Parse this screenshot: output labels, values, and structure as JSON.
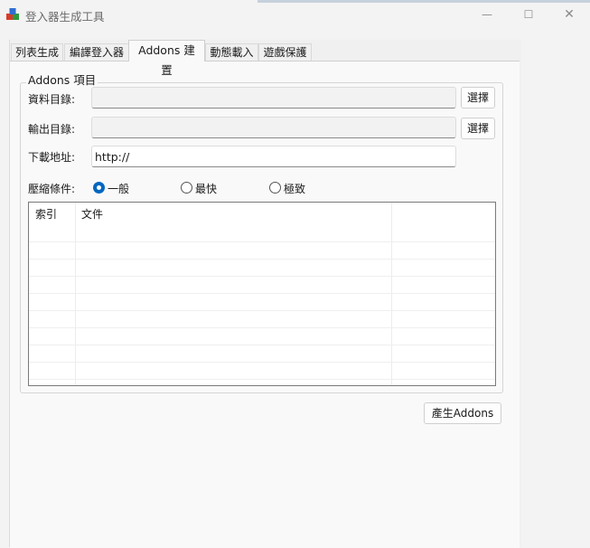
{
  "window": {
    "title": "登入器生成工具",
    "minimize_glyph": "—",
    "maximize_glyph": "☐",
    "close_glyph": "✕"
  },
  "tabs": [
    {
      "label": "列表生成"
    },
    {
      "label": "編譯登入器"
    },
    {
      "label": "Addons 建置"
    },
    {
      "label": "動態載入"
    },
    {
      "label": "遊戲保護"
    }
  ],
  "active_tab": 2,
  "group": {
    "title": "Addons 項目",
    "data_dir_label": "資料目錄:",
    "data_dir_value": "",
    "output_dir_label": "輸出目錄:",
    "output_dir_value": "",
    "browse_label": "選擇",
    "download_label": "下載地址:",
    "download_value": "http://",
    "compression_label": "壓縮條件:",
    "compression_options": [
      "一般",
      "最快",
      "極致"
    ],
    "compression_selected": "一般",
    "list_columns": [
      "索引",
      "文件",
      ""
    ]
  },
  "generate_button": "產生Addons",
  "icons": {
    "app": "app-cubes-icon",
    "minimize": "minimize-icon",
    "maximize": "maximize-icon",
    "close": "close-icon"
  }
}
